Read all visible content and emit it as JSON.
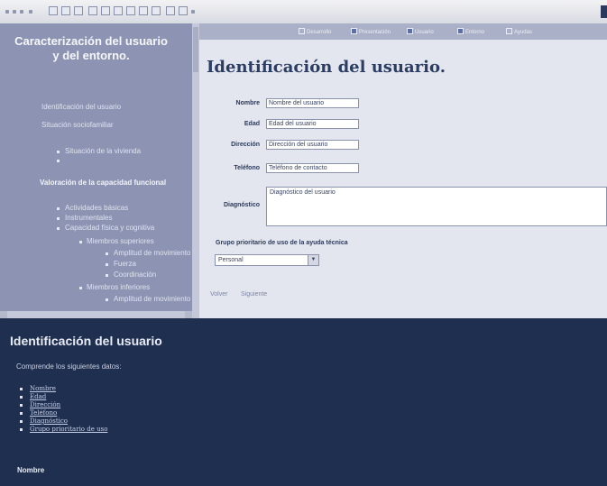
{
  "toolbar": {
    "icons": [
      "back-icon",
      "forward-icon",
      "refresh-icon",
      "home-icon",
      "folder-icon",
      "save-icon",
      "print-icon",
      "edit-icon",
      "cut-icon",
      "copy-icon",
      "paste-icon",
      "undo-icon",
      "redo-icon",
      "dropdown-icon"
    ]
  },
  "sidebar": {
    "title_line1": "Caracterización del usuario",
    "title_line2": "y del entorno.",
    "items": [
      {
        "label": "Identificación del usuario",
        "bold": false
      },
      {
        "label": "Situación sociofamiliar",
        "bold": false
      },
      {
        "label": "Situación de la vivienda",
        "bold": false
      },
      {
        "label": "Valoración de la capacidad funcional",
        "bold": true
      },
      {
        "label": "Actividades básicas",
        "bold": false
      },
      {
        "label": "Instrumentales",
        "bold": false
      },
      {
        "label": "Capacidad física y cognitiva",
        "bold": false
      },
      {
        "label": "Miembros superiores",
        "bold": false
      },
      {
        "label": "Amplitud de movimiento",
        "bold": false
      },
      {
        "label": "Fuerza",
        "bold": false
      },
      {
        "label": "Coordinación",
        "bold": false
      },
      {
        "label": "Miembros inferiores",
        "bold": false
      },
      {
        "label": "Amplitud de movimiento",
        "bold": false
      }
    ]
  },
  "tabs": [
    {
      "label": "Desarrollo",
      "on": false
    },
    {
      "label": "Presentación",
      "on": true
    },
    {
      "label": "Usuario",
      "on": true
    },
    {
      "label": "Entorno",
      "on": true
    },
    {
      "label": "Ayudas",
      "on": false
    }
  ],
  "form": {
    "title": "Identificación del usuario.",
    "fields": [
      {
        "label": "Nombre",
        "value": "Nombre del usuario"
      },
      {
        "label": "Edad",
        "value": "Edad del usuario"
      },
      {
        "label": "Dirección",
        "value": "Dirección del usuario"
      },
      {
        "label": "Teléfono",
        "value": "Teléfono de contacto"
      }
    ],
    "diagnosis_label": "Diagnóstico",
    "diagnosis_value": "Diagnóstico del usuario",
    "group_label": "Grupo prioritario de uso de la ayuda técnica",
    "select_value": "Personal",
    "links": [
      "Volver",
      "Siguiente"
    ]
  },
  "help": {
    "title": "Identificación del usuario",
    "text": "Comprende los siguientes datos:",
    "items": [
      "Nombre",
      "Edad",
      "Dirección",
      "Teléfono",
      "Diagnóstico",
      "Grupo prioritario de uso"
    ],
    "subheading": "Nombre"
  }
}
